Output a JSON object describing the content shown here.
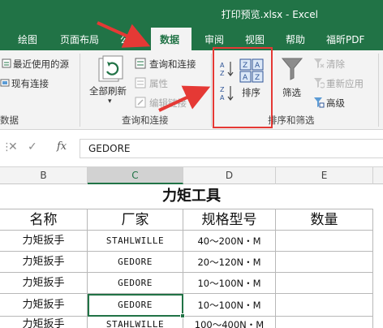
{
  "window": {
    "title": "打印预览.xlsx  -  Excel"
  },
  "tabs": {
    "draw": "绘图",
    "layout": "页面布局",
    "formula": "公",
    "data": "数据",
    "review": "审阅",
    "view": "视图",
    "help": "帮助",
    "foxit": "福昕PDF"
  },
  "ribbon": {
    "get_data": {
      "recent_sources": "最近使用的源",
      "existing_connections": "现有连接",
      "group_label": "数据"
    },
    "queries": {
      "refresh_all": "全部刷新",
      "queries_connections": "查询和连接",
      "properties": "属性",
      "edit_links": "编辑链接",
      "group_label": "查询和连接"
    },
    "sort_filter": {
      "sort": "排序",
      "filter": "筛选",
      "clear": "清除",
      "reapply": "重新应用",
      "advanced": "高级",
      "group_label": "排序和筛选"
    }
  },
  "formula_bar": {
    "fx": "fx",
    "value": "GEDORE"
  },
  "columns": [
    "B",
    "C",
    "D",
    "E"
  ],
  "sheet": {
    "title": "力矩工具",
    "headers": [
      "名称",
      "厂家",
      "规格型号",
      "数量"
    ],
    "rows": [
      {
        "name": "力矩扳手",
        "maker": "STAHLWILLE",
        "spec": "40～200N・M",
        "qty": ""
      },
      {
        "name": "力矩扳手",
        "maker": "GEDORE",
        "spec": "20～120N・M",
        "qty": ""
      },
      {
        "name": "力矩扳手",
        "maker": "GEDORE",
        "spec": "10～100N・M",
        "qty": ""
      },
      {
        "name": "力矩扳手",
        "maker": "GEDORE",
        "spec": "10～100N・M",
        "qty": ""
      },
      {
        "name": "力矩扳手",
        "maker": "STAHLWILLE",
        "spec": "100～400N・M",
        "qty": ""
      }
    ]
  },
  "colors": {
    "excel_green": "#217346",
    "annotation_red": "#e53935"
  },
  "icons": [
    "sort-az-icon",
    "sort-za-icon",
    "sort-dialog-icon",
    "filter-funnel-icon",
    "clear-filter-icon",
    "reapply-icon",
    "advanced-filter-icon",
    "refresh-icon",
    "cancel-icon",
    "confirm-icon"
  ]
}
